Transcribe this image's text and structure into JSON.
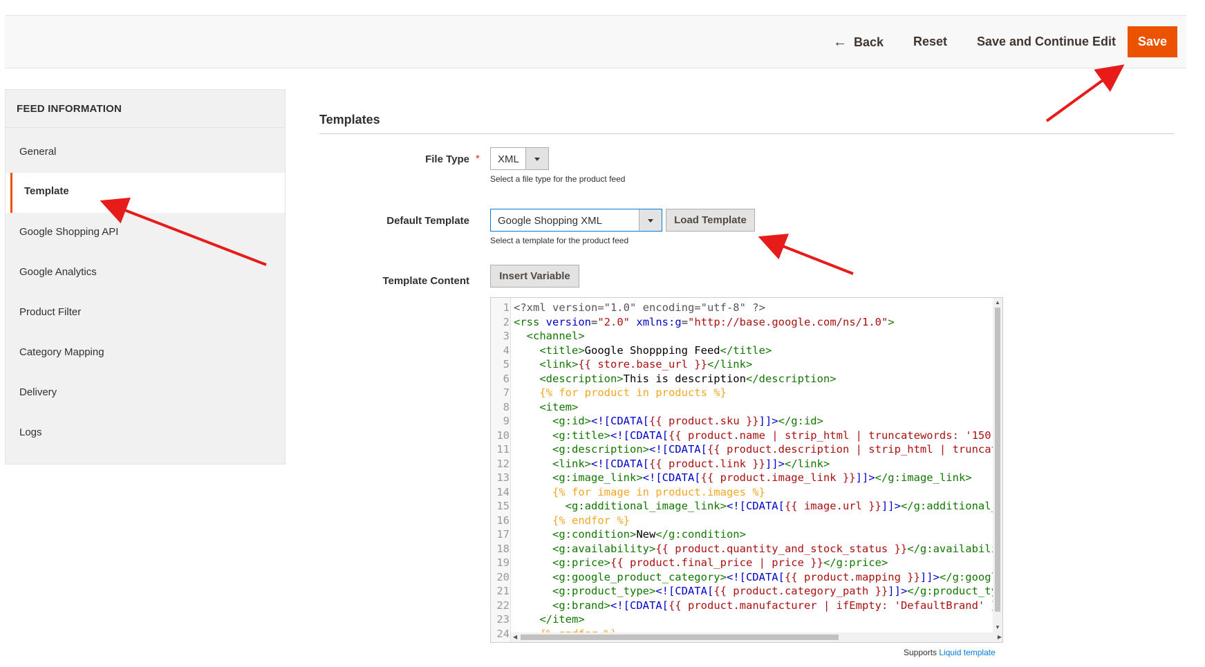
{
  "toolbar": {
    "back_label": "Back",
    "reset_label": "Reset",
    "save_continue_label": "Save and Continue Edit",
    "save_label": "Save"
  },
  "sidebar": {
    "heading": "FEED INFORMATION",
    "items": [
      {
        "label": "General"
      },
      {
        "label": "Template",
        "active": true
      },
      {
        "label": "Google Shopping API"
      },
      {
        "label": "Google Analytics"
      },
      {
        "label": "Product Filter"
      },
      {
        "label": "Category Mapping"
      },
      {
        "label": "Delivery"
      },
      {
        "label": "Logs"
      }
    ]
  },
  "main": {
    "section_title": "Templates",
    "file_type": {
      "label": "File Type",
      "value": "XML",
      "note": "Select a file type for the product feed"
    },
    "default_template": {
      "label": "Default Template",
      "value": "Google Shopping XML",
      "note": "Select a template for the product feed",
      "load_button": "Load Template"
    },
    "template_content": {
      "label": "Template Content",
      "insert_variable_button": "Insert Variable"
    },
    "supports_prefix": "Supports",
    "supports_link": "Liquid template"
  },
  "editor": {
    "lines": [
      "1",
      "2",
      "3",
      "4",
      "5",
      "6",
      "7",
      "8",
      "9",
      "10",
      "11",
      "12",
      "13",
      "14",
      "15",
      "16",
      "17",
      "18",
      "19",
      "20",
      "21",
      "22",
      "23",
      "24"
    ]
  },
  "colors": {
    "accent": "#eb5202",
    "annotation_arrow": "#e81b1b",
    "link": "#007bdb"
  }
}
